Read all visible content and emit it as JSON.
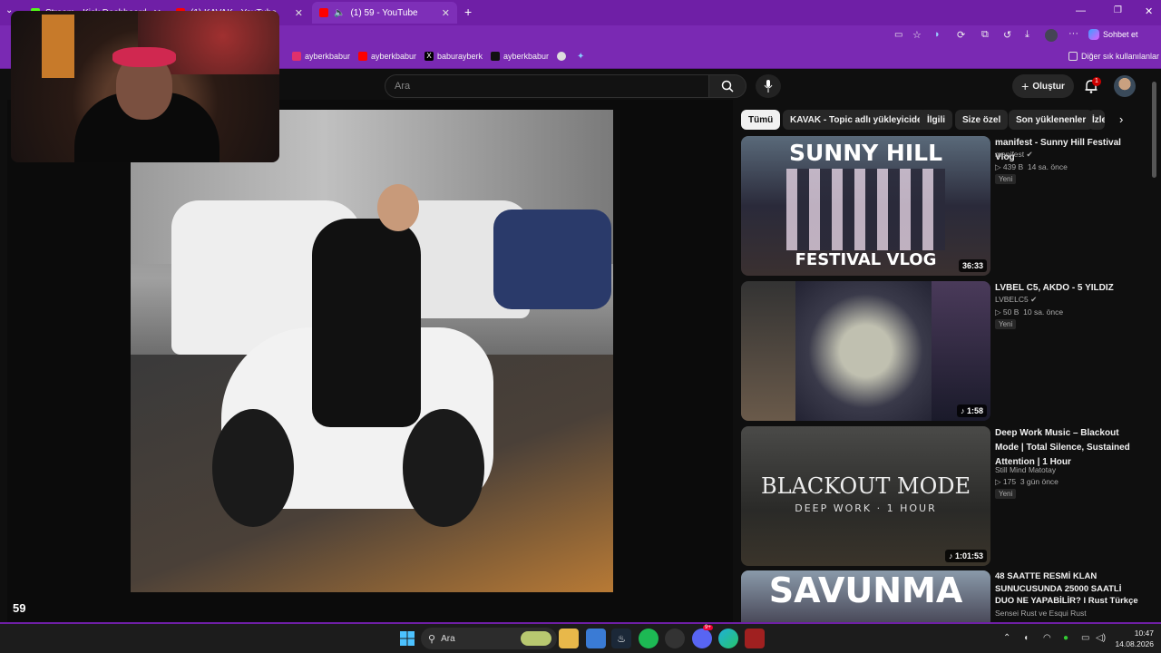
{
  "browser": {
    "tabs": [
      {
        "label": "Stream - Kick Dashboard",
        "active": false
      },
      {
        "label": "(1) KAVAK - YouTube",
        "active": false
      },
      {
        "label": "(1) 59 - YouTube",
        "active": true
      }
    ],
    "new_tab_icon": "plus-icon",
    "window_controls": [
      "minimize-icon",
      "restore-icon",
      "close-icon"
    ],
    "copilot_label": "Sohbet et",
    "favorites": [
      {
        "label": "ayberkbabur",
        "icon": "instagram-icon",
        "color": "#e1306c"
      },
      {
        "label": "ayberkbabur",
        "icon": "youtube-icon",
        "color": "#ff0000"
      },
      {
        "label": "baburayberk",
        "icon": "x-icon",
        "color": "#000000"
      },
      {
        "label": "ayberkbabur",
        "icon": "tiktok-icon",
        "color": "#111111"
      }
    ],
    "other_favorites": "Diğer sık kullanılanlar"
  },
  "youtube": {
    "search_placeholder": "Ara",
    "create_label": "Oluştur",
    "notification_count": "1",
    "chips": [
      "Tümü",
      "KAVAK - Topic adlı yükleyiciden",
      "İlgili",
      "Size özel",
      "Son yüklenenler",
      "İzle"
    ],
    "player_counter": "59",
    "recommendations": [
      {
        "title": "manifest - Sunny Hill Festival Vlog",
        "channel": "manifest",
        "verified": true,
        "views": "439 B",
        "age": "14 sa. önce",
        "badge": "Yeni",
        "duration": "36:33",
        "thumb_top": "SUNNY HILL",
        "thumb_bottom": "FESTIVAL VLOG"
      },
      {
        "title": "LVBEL C5, AKDO - 5 YILDIZ",
        "channel": "LVBELC5",
        "verified": true,
        "views": "50 B",
        "age": "10 sa. önce",
        "badge": "Yeni",
        "duration": "1:58"
      },
      {
        "title": "Deep Work Music – Blackout Mode | Total Silence, Sustained Attention | 1 Hour",
        "channel": "Still Mind Matotay",
        "verified": false,
        "views": "175",
        "age": "3 gün önce",
        "badge": "Yeni",
        "duration": "1:01:53",
        "thumb_top": "BLACKOUT MODE",
        "thumb_bottom": "DEEP WORK · 1 HOUR"
      },
      {
        "title": "48 SAATTE RESMİ KLAN SUNUCUSUNDA 25000 SAATLİ DUO NE YAPABİLİR? l Rust Türkçe",
        "channel": "Sensei Rust ve Esqui Rust",
        "verified": false,
        "thumb_top": "SAVUNMA"
      }
    ]
  },
  "taskbar": {
    "search_label": "Ara",
    "time": "10:47",
    "date": "14.08.2026",
    "discord_badge": "9+",
    "colors": {
      "accent": "#6f1fa6",
      "spotify": "#1db954"
    }
  }
}
